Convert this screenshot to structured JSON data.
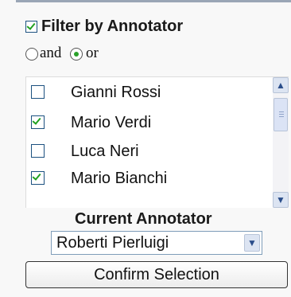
{
  "filter": {
    "label": "Filter by Annotator",
    "checked": true
  },
  "mode": {
    "and_label": "and",
    "or_label": "or",
    "selected": "or"
  },
  "annotators": [
    {
      "label": "Gianni Rossi",
      "checked": false
    },
    {
      "label": "Mario Verdi",
      "checked": true
    },
    {
      "label": "Luca Neri",
      "checked": false
    },
    {
      "label": "Mario Bianchi",
      "checked": true
    }
  ],
  "current": {
    "title": "Current Annotator",
    "selected": "Roberti Pierluigi"
  },
  "confirm_label": "Confirm Selection",
  "icons": {
    "scroll_up": "chevron-up-icon",
    "scroll_down": "chevron-down-icon",
    "select_arrow": "chevron-down-icon"
  },
  "colors": {
    "check": "#21a121",
    "accent": "#2a4d8a"
  }
}
